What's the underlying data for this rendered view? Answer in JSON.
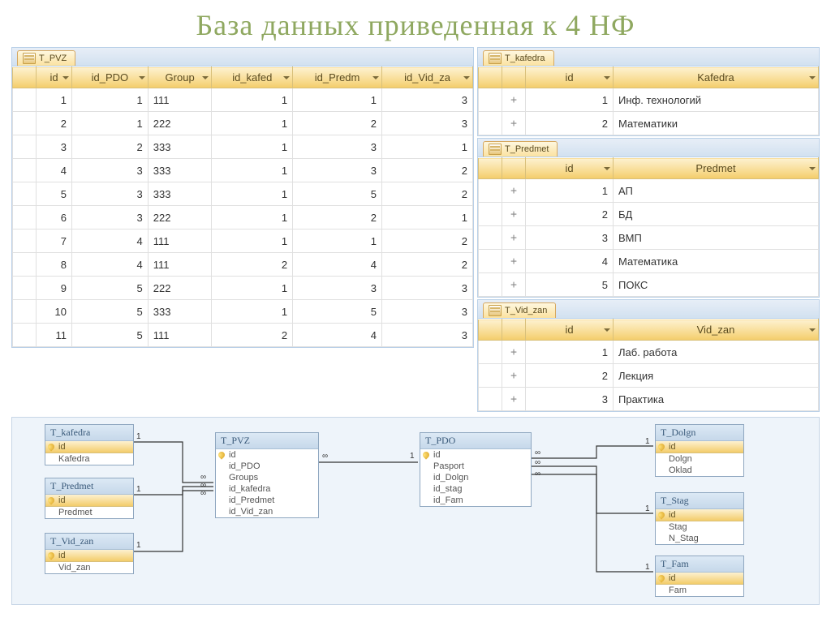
{
  "title": "База данных приведенная к 4 НФ",
  "tables": {
    "pvz": {
      "tab": "T_PVZ",
      "headers": [
        "id",
        "id_PDO",
        "Group",
        "id_kafed",
        "id_Predm",
        "id_Vid_za"
      ],
      "rows": [
        {
          "id": 1,
          "id_PDO": 1,
          "Group": "111",
          "id_kafed": 1,
          "id_Predm": 1,
          "id_Vid_za": 3
        },
        {
          "id": 2,
          "id_PDO": 1,
          "Group": "222",
          "id_kafed": 1,
          "id_Predm": 2,
          "id_Vid_za": 3
        },
        {
          "id": 3,
          "id_PDO": 2,
          "Group": "333",
          "id_kafed": 1,
          "id_Predm": 3,
          "id_Vid_za": 1
        },
        {
          "id": 4,
          "id_PDO": 3,
          "Group": "333",
          "id_kafed": 1,
          "id_Predm": 3,
          "id_Vid_za": 2
        },
        {
          "id": 5,
          "id_PDO": 3,
          "Group": "333",
          "id_kafed": 1,
          "id_Predm": 5,
          "id_Vid_za": 2
        },
        {
          "id": 6,
          "id_PDO": 3,
          "Group": "222",
          "id_kafed": 1,
          "id_Predm": 2,
          "id_Vid_za": 1
        },
        {
          "id": 7,
          "id_PDO": 4,
          "Group": "111",
          "id_kafed": 1,
          "id_Predm": 1,
          "id_Vid_za": 2
        },
        {
          "id": 8,
          "id_PDO": 4,
          "Group": "111",
          "id_kafed": 2,
          "id_Predm": 4,
          "id_Vid_za": 2
        },
        {
          "id": 9,
          "id_PDO": 5,
          "Group": "222",
          "id_kafed": 1,
          "id_Predm": 3,
          "id_Vid_za": 3
        },
        {
          "id": 10,
          "id_PDO": 5,
          "Group": "333",
          "id_kafed": 1,
          "id_Predm": 5,
          "id_Vid_za": 3
        },
        {
          "id": 11,
          "id_PDO": 5,
          "Group": "111",
          "id_kafed": 2,
          "id_Predm": 4,
          "id_Vid_za": 3
        }
      ]
    },
    "kafedra": {
      "tab": "T_kafedra",
      "headers": [
        "id",
        "Kafedra"
      ],
      "rows": [
        {
          "id": 1,
          "val": "Инф. технологий"
        },
        {
          "id": 2,
          "val": "Математики"
        }
      ]
    },
    "predmet": {
      "tab": "T_Predmet",
      "headers": [
        "id",
        "Predmet"
      ],
      "rows": [
        {
          "id": 1,
          "val": "АП"
        },
        {
          "id": 2,
          "val": "БД"
        },
        {
          "id": 3,
          "val": "ВМП"
        },
        {
          "id": 4,
          "val": "Математика"
        },
        {
          "id": 5,
          "val": "ПОКС"
        }
      ]
    },
    "vidzan": {
      "tab": "T_Vid_zan",
      "headers": [
        "id",
        "Vid_zan"
      ],
      "rows": [
        {
          "id": 1,
          "val": "Лаб. работа"
        },
        {
          "id": 2,
          "val": "Лекция"
        },
        {
          "id": 3,
          "val": "Практика"
        }
      ]
    }
  },
  "diagram": {
    "entities": {
      "t_kafedra": {
        "title": "T_kafedra",
        "fields": [
          "id",
          "Kafedra"
        ],
        "pk": [
          0
        ]
      },
      "t_predmet": {
        "title": "T_Predmet",
        "fields": [
          "id",
          "Predmet"
        ],
        "pk": [
          0
        ]
      },
      "t_vid_zan": {
        "title": "T_Vid_zan",
        "fields": [
          "id",
          "Vid_zan"
        ],
        "pk": [
          0
        ]
      },
      "t_pvz": {
        "title": "T_PVZ",
        "fields": [
          "id",
          "id_PDO",
          "Groups",
          "id_kafedra",
          "id_Predmet",
          "id_Vid_zan"
        ],
        "pk": [
          0
        ]
      },
      "t_pdo": {
        "title": "T_PDO",
        "fields": [
          "id",
          "Pasport",
          "id_Dolgn",
          "id_stag",
          "id_Fam"
        ],
        "pk": [
          0
        ]
      },
      "t_dolgn": {
        "title": "T_Dolgn",
        "fields": [
          "id",
          "Dolgn",
          "Oklad"
        ],
        "pk": [
          0
        ]
      },
      "t_stag": {
        "title": "T_Stag",
        "fields": [
          "id",
          "Stag",
          "N_Stag"
        ],
        "pk": [
          0
        ]
      },
      "t_fam": {
        "title": "T_Fam",
        "fields": [
          "id",
          "Fam"
        ],
        "pk": [
          0
        ]
      }
    },
    "card_one": "1",
    "card_many": "∞"
  }
}
